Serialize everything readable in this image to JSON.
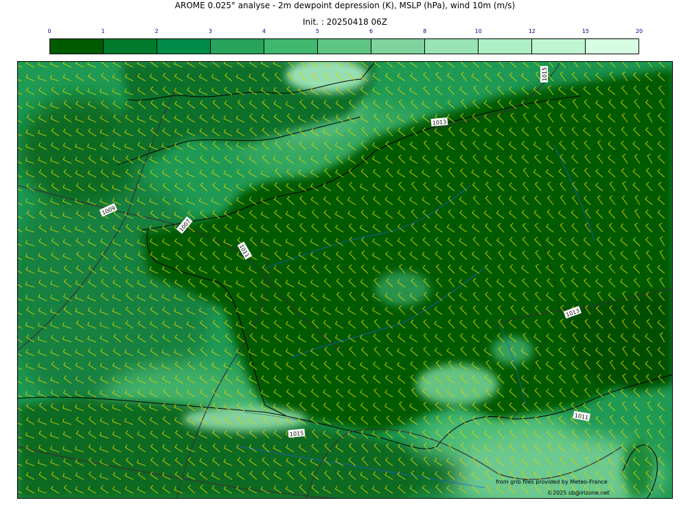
{
  "header": {
    "title": "AROME 0.025° analyse - 2m dewpoint depression (K), MSLP (hPa), wind 10m (m/s)",
    "init": "Init. : 20250418 06Z"
  },
  "colorbar": {
    "ticks": [
      "0",
      "1",
      "2",
      "3",
      "4",
      "5",
      "6",
      "8",
      "10",
      "12",
      "15",
      "20"
    ],
    "colors": [
      "#005a00",
      "#007a2c",
      "#008c48",
      "#27a35c",
      "#40b96f",
      "#5fc585",
      "#7fd39c",
      "#9ae3b3",
      "#afefc5",
      "#c0f5d2",
      "#d6fce2"
    ],
    "tick_color": "#000080"
  },
  "map": {
    "isobar_labels": [
      "1015",
      "1013",
      "1009",
      "1007",
      "1011",
      "1013",
      "1011",
      "1015"
    ],
    "colors": {
      "land_dark": "#005a00",
      "sea": "#27a35c",
      "coast": "#000000",
      "isobar": "#333333",
      "wind": "#d4d400",
      "river": "#1a5fd6"
    }
  },
  "credits": {
    "source": "from grib files provided by Meteo-France",
    "copyright": "©2025 sb@irizone.net"
  }
}
